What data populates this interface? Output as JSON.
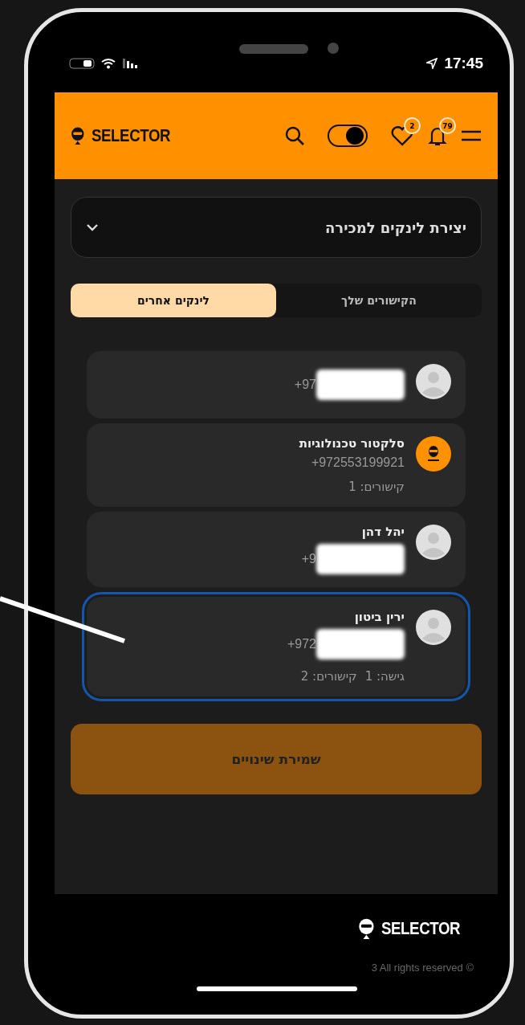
{
  "status_bar": {
    "time": "17:45"
  },
  "header": {
    "logo": "SELECTOR",
    "dark_mode": true,
    "favorites_count": "2",
    "notifications_count": "79"
  },
  "dropdown": {
    "title": "יצירת לינקים למכירה",
    "expanded": false
  },
  "tabs": [
    {
      "label": "הקישורים שלך",
      "selected": false
    },
    {
      "label": "לינקים אחרים",
      "selected": true
    }
  ],
  "contacts": [
    {
      "kind": "person",
      "phone": "+97",
      "redacted": true,
      "selected": false
    },
    {
      "kind": "logo",
      "name": "סלקטור טכנולוגיות",
      "phone": "+972553199921",
      "redacted": false,
      "stats": [
        "קישורים: 1"
      ],
      "selected": false
    },
    {
      "kind": "person",
      "name": "יהל דהן",
      "phone": "+9",
      "redacted": true,
      "selected": false
    },
    {
      "kind": "person",
      "name": "ירין ביטון",
      "phone": "+972",
      "redacted": true,
      "stats": [
        "גישה: 1",
        "קישורים: 2"
      ],
      "selected": true
    }
  ],
  "save_button": "שמירת שינויים",
  "footer": {
    "logo": "SELECTOR",
    "copyright": "3 All rights reserved ©"
  }
}
